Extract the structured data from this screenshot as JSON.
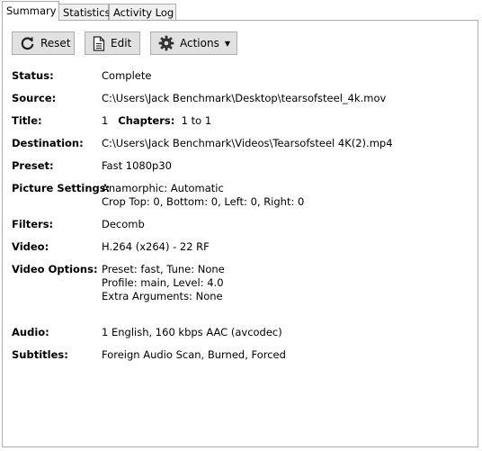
{
  "tabs": [
    {
      "label": "Summary"
    },
    {
      "label": "Statistics"
    },
    {
      "label": "Activity Log"
    }
  ],
  "toolbar": {
    "reset_label": "Reset",
    "edit_label": "Edit",
    "actions_label": "Actions"
  },
  "summary": {
    "status": {
      "label": "Status:",
      "value": "Complete"
    },
    "source": {
      "label": "Source:",
      "value": "C:\\Users\\Jack Benchmark\\Desktop\\tearsofsteel_4k.mov"
    },
    "title": {
      "label": "Title:",
      "value": "1",
      "chapters_label": "Chapters:",
      "chapters_value": "1 to 1"
    },
    "destination": {
      "label": "Destination:",
      "value": "C:\\Users\\Jack Benchmark\\Videos\\Tearsofsteel 4K(2).mp4"
    },
    "preset": {
      "label": "Preset:",
      "value": "Fast 1080p30"
    },
    "picture_settings": {
      "label": "Picture Settings:",
      "line1": "Anamorphic: Automatic",
      "line2": "Crop Top: 0, Bottom: 0, Left: 0, Right: 0"
    },
    "filters": {
      "label": "Filters:",
      "value": "Decomb"
    },
    "video": {
      "label": "Video:",
      "value": "H.264 (x264) - 22 RF"
    },
    "video_options": {
      "label": "Video Options:",
      "line1": "Preset: fast, Tune: None",
      "line2": "Profile: main, Level: 4.0",
      "line3": "Extra Arguments: None"
    },
    "audio": {
      "label": "Audio:",
      "value": "1 English, 160 kbps AAC (avcodec)"
    },
    "subtitles": {
      "label": "Subtitles:",
      "value": "Foreign Audio Scan, Burned, Forced"
    }
  }
}
